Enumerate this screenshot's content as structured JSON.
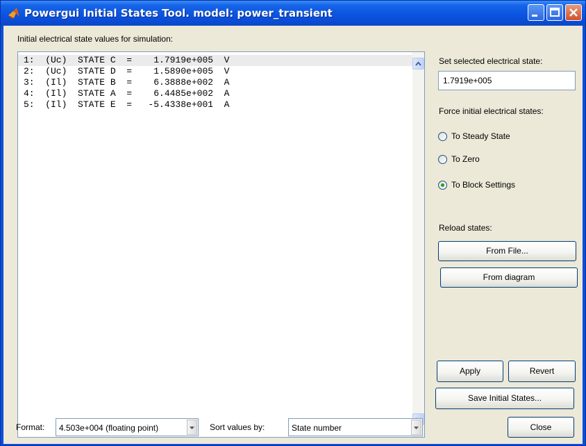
{
  "window": {
    "title": "Powergui Initial States Tool. model: power_transient",
    "icon": "matlab-logo-icon"
  },
  "states_panel": {
    "heading": "Initial electrical state values for simulation:",
    "rows": [
      "1:  (Uc)  STATE C  =    1.7919e+005  V",
      "2:  (Uc)  STATE D  =    1.5890e+005  V",
      "3:  (Il)  STATE B  =    6.3888e+002  A",
      "4:  (Il)  STATE A  =    6.4485e+002  A",
      "5:  (Il)  STATE E  =   -5.4338e+001  A"
    ],
    "selected_index": 0
  },
  "right_panel": {
    "set_selected_label": "Set selected electrical state:",
    "set_selected_value": "1.7919e+005",
    "force_label": "Force initial electrical states:",
    "radios": [
      {
        "label": "To Steady State",
        "checked": false
      },
      {
        "label": "To Zero",
        "checked": false
      },
      {
        "label": "To Block Settings",
        "checked": true
      }
    ],
    "reload_label": "Reload states:",
    "from_file_button": "From File...",
    "from_diagram_button": "From diagram",
    "apply_button": "Apply",
    "revert_button": "Revert",
    "save_button": "Save Initial States...",
    "close_button": "Close"
  },
  "bottom_bar": {
    "format_label": "Format:",
    "format_value": "4.503e+004 (floating point)",
    "sort_label": "Sort values by:",
    "sort_value": "State number"
  },
  "colors": {
    "titlebar": "#0b54e0",
    "dialog_background": "#ece9d8",
    "radio_dot": "#21a121"
  }
}
